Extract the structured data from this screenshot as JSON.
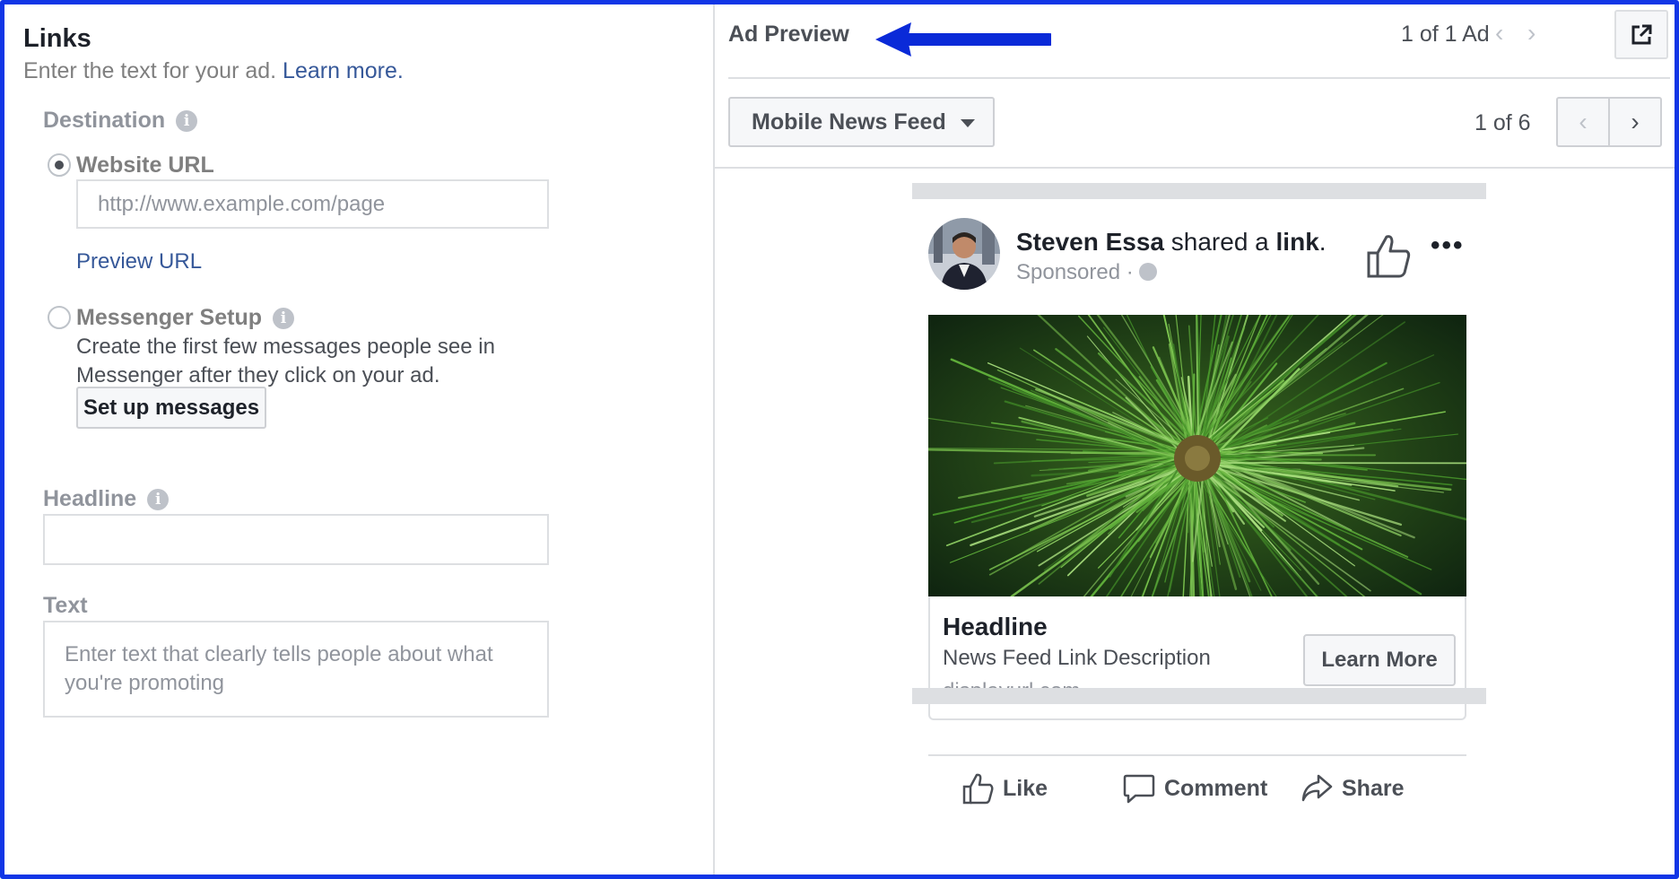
{
  "links_panel": {
    "title": "Links",
    "subtitle": "Enter the text for your ad.",
    "learn_more": "Learn more.",
    "destination_label": "Destination",
    "website_url_label": "Website URL",
    "website_url_placeholder": "http://www.example.com/page",
    "preview_url": "Preview URL",
    "messenger_setup_label": "Messenger Setup",
    "messenger_desc": "Create the first few messages people see in Messenger after they click on your ad.",
    "setup_messages_button": "Set up messages",
    "headline_label": "Headline",
    "headline_value": "",
    "text_label": "Text",
    "text_placeholder": "Enter text that clearly tells people about what you're promoting"
  },
  "ad_preview": {
    "title": "Ad Preview",
    "ad_count": "1 of 1 Ad",
    "placement": "Mobile News Feed",
    "page_count": "1 of 6"
  },
  "post": {
    "author": "Steven Essa",
    "shared_text": "shared a",
    "link_word": "link",
    "period": ".",
    "sponsored": "Sponsored ·",
    "more": "•••",
    "headline": "Headline",
    "description": "News Feed Link Description",
    "display_url": "displayurl.com",
    "cta": "Learn More",
    "actions": {
      "like": "Like",
      "comment": "Comment",
      "share": "Share"
    }
  },
  "colors": {
    "frame": "#1136e6",
    "link": "#365899",
    "arrow": "#0a2ad8"
  }
}
